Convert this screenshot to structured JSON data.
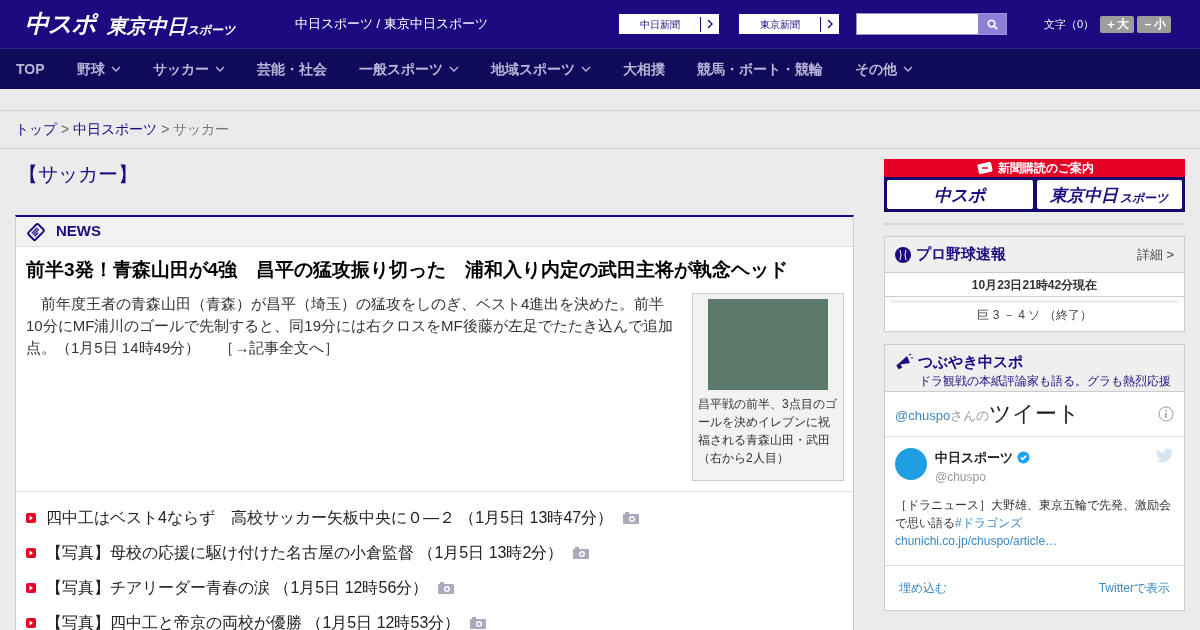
{
  "header": {
    "logo_main": "中スポ",
    "logo_tokyo": "東京中日",
    "logo_tokyo_sub": "スポーツ",
    "site_title": "中日スポーツ / 東京中日スポーツ",
    "links": [
      "中日新聞",
      "東京新聞"
    ],
    "font_size_label": "文字（0）",
    "font_buttons": [
      {
        "sign": "＋",
        "label": "大"
      },
      {
        "sign": "－",
        "label": "小"
      }
    ]
  },
  "nav": [
    {
      "label": "TOP",
      "has_menu": false
    },
    {
      "label": "野球",
      "has_menu": true
    },
    {
      "label": "サッカー",
      "has_menu": true
    },
    {
      "label": "芸能・社会",
      "has_menu": false
    },
    {
      "label": "一般スポーツ",
      "has_menu": true
    },
    {
      "label": "地域スポーツ",
      "has_menu": true
    },
    {
      "label": "大相撲",
      "has_menu": false
    },
    {
      "label": "競馬・ボート・競輪",
      "has_menu": false
    },
    {
      "label": "その他",
      "has_menu": true
    }
  ],
  "breadcrumb": [
    {
      "label": "トップ",
      "link": true
    },
    {
      "separator": ">",
      "label": "中日スポーツ",
      "link": true
    },
    {
      "separator": ">",
      "label": "サッカー",
      "link": false
    }
  ],
  "page_title": "【サッカー】",
  "news": {
    "heading": "NEWS",
    "headline": "前半3発！青森山田が4強　昌平の猛攻振り切った　浦和入り内定の武田主将が執念ヘッド",
    "body": "　前年度王者の青森山田（青森）が昌平（埼玉）の猛攻をしのぎ、ベスト4進出を決めた。前半10分にMF浦川のゴールで先制すると、同19分には右クロスをMF後藤が左足でたたき込んで追加点。（1月5日 14時49分）",
    "more_link": "［→記事全文へ］",
    "photo_caption": "昌平戦の前半、3点目のゴールを決めイレブンに祝福される青森山田・武田（右から2人目）",
    "items": [
      {
        "title": "四中工はベスト4ならず　高校サッカー矢板中央に０―２",
        "time": "（1月5日 13時47分）",
        "has_photo": true
      },
      {
        "title": "【写真】母校の応援に駆け付けた名古屋の小倉監督",
        "time": "（1月5日 13時2分）",
        "has_photo": true
      },
      {
        "title": "【写真】チアリーダー青春の涙",
        "time": "（1月5日 12時56分）",
        "has_photo": true
      },
      {
        "title": "【写真】四中工と帝京の両校が優勝",
        "time": "（1月5日 12時53分）",
        "has_photo": true
      }
    ]
  },
  "sidebar": {
    "subscription": {
      "title": "新聞購読のご案内",
      "buttons": [
        {
          "label": "中スポ"
        },
        {
          "label": "東京中日",
          "sub": "スポーツ"
        }
      ]
    },
    "baseball": {
      "title": "プロ野球速報",
      "detail": "詳細 >",
      "updated": "10月23日21時42分現在",
      "score": "巨 3 － 4 ソ （終了）"
    },
    "tweets": {
      "title": "つぶやき中スポ",
      "subtitle": "ドラ観戦の本紙評論家も語る。グラも熱烈応援",
      "handle_prefix": "@chuspo",
      "handle_suffix": "さんの",
      "heading": "ツイート",
      "account_name": "中日スポーツ",
      "account_handle": "@chuspo",
      "text": "［ドラニュース］大野雄、東京五輪で先発、激励会で思い語る",
      "hashtag": "#ドラゴンズ",
      "url": "chunichi.co.jp/chuspo/article…",
      "embed": "埋め込む",
      "view": "Twitterで表示"
    }
  }
}
